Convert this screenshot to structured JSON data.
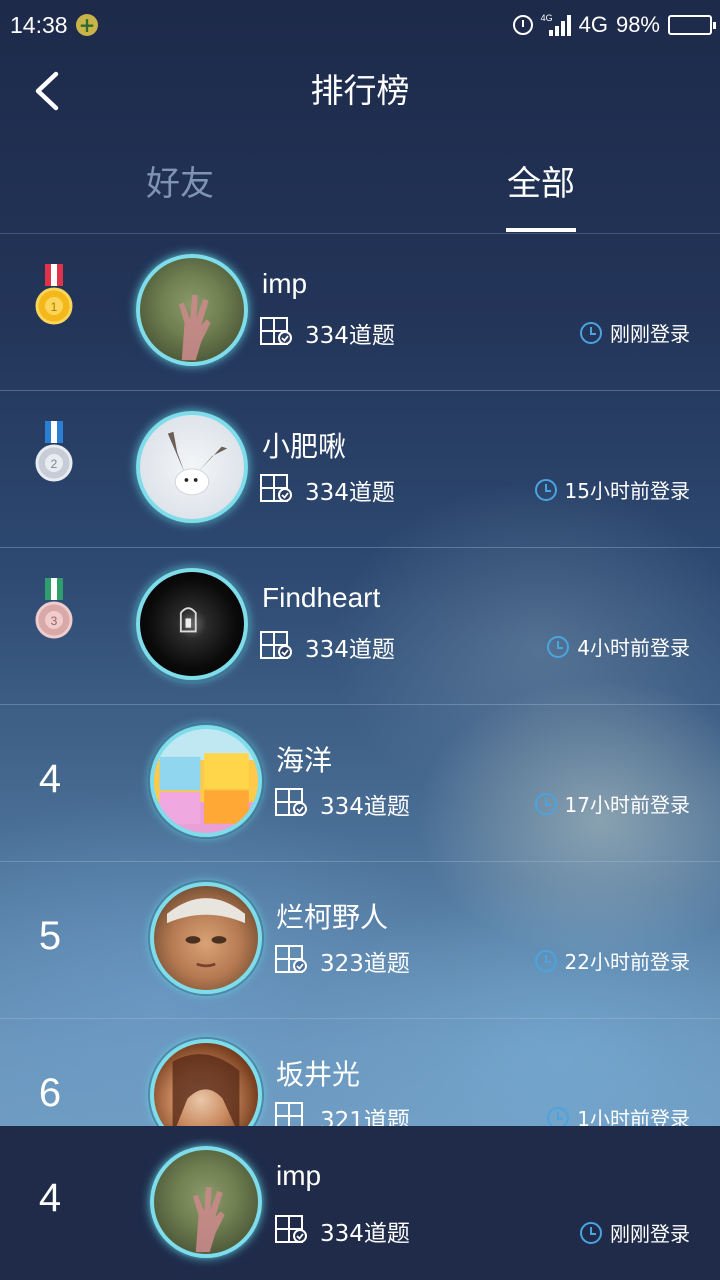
{
  "status_bar": {
    "time": "14:38",
    "network": "4G",
    "battery": "98%",
    "network_small": "4G"
  },
  "header": {
    "title": "排行榜"
  },
  "tabs": [
    {
      "label": "好友",
      "active": false
    },
    {
      "label": "全部",
      "active": true
    }
  ],
  "rows": [
    {
      "rank": "1",
      "medal": "gold",
      "name": "imp",
      "count": "334道题",
      "login": "刚刚登录",
      "avatar": "cactus-hand"
    },
    {
      "rank": "2",
      "medal": "silver",
      "name": "小肥啾",
      "count": "334道题",
      "login": "15小时前登录",
      "avatar": "bird"
    },
    {
      "rank": "3",
      "medal": "bronze",
      "name": "Findheart",
      "count": "334道题",
      "login": "4小时前登录",
      "avatar": "tunnel"
    },
    {
      "rank": "4",
      "medal": "",
      "name": "海洋",
      "count": "334道题",
      "login": "17小时前登录",
      "avatar": "boxes"
    },
    {
      "rank": "5",
      "medal": "",
      "name": "烂柯野人",
      "count": "323道题",
      "login": "22小时前登录",
      "avatar": "man"
    },
    {
      "rank": "6",
      "medal": "",
      "name": "坂井光",
      "count": "321道题",
      "login": "1小时前登录",
      "avatar": "girl"
    }
  ],
  "my_rank": {
    "rank": "4",
    "name": "imp",
    "count": "334道题",
    "login": "刚刚登录"
  },
  "colors": {
    "accent_blue": "#4aa4e0",
    "avatar_ring": "#7fdcea",
    "inactive_tab": "#7e93b6",
    "footer_bg": "#1f2b49"
  }
}
